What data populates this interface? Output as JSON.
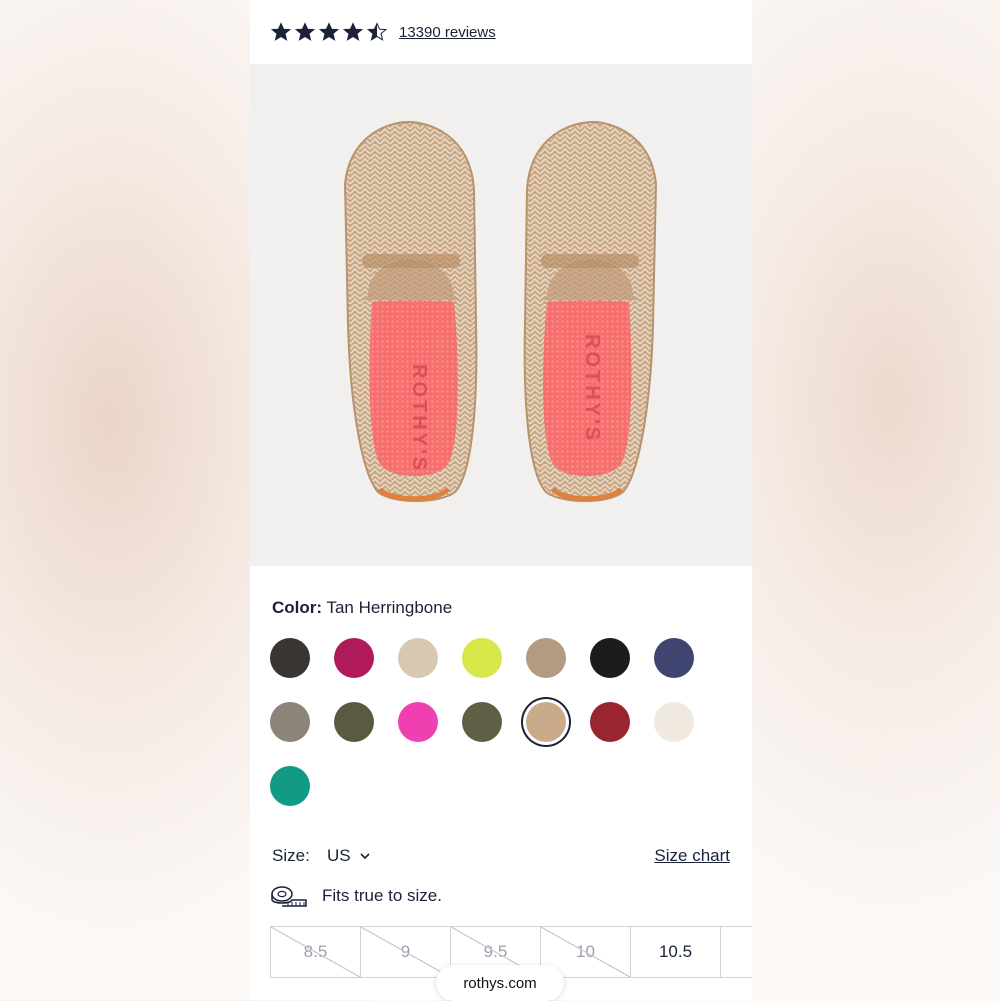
{
  "rating": {
    "value": 4.5,
    "max": 5,
    "reviews_label": "13390 reviews",
    "star_color": "#1a2238"
  },
  "product_image": {
    "insole_brand": "ROTHY'S"
  },
  "color": {
    "label": "Color:",
    "value": "Tan Herringbone"
  },
  "swatches": [
    {
      "name": "leopard",
      "color": "#3a3530"
    },
    {
      "name": "raspberry",
      "color": "#b0195a"
    },
    {
      "name": "beige",
      "color": "#d8c7b1"
    },
    {
      "name": "lime",
      "color": "#d7e649"
    },
    {
      "name": "tan-weave",
      "color": "#b39a80"
    },
    {
      "name": "black",
      "color": "#1c1c1c"
    },
    {
      "name": "navy",
      "color": "#3f4470"
    },
    {
      "name": "grey-herringbone",
      "color": "#8c8479"
    },
    {
      "name": "olive",
      "color": "#5a5a42"
    },
    {
      "name": "pink",
      "color": "#ef3fb0"
    },
    {
      "name": "camo",
      "color": "#5f5f45"
    },
    {
      "name": "tan-herringbone",
      "color": "#c9ab8c",
      "selected": true
    },
    {
      "name": "crimson",
      "color": "#9a2530"
    },
    {
      "name": "cream",
      "color": "#efe9df"
    },
    {
      "name": "teal",
      "color": "#119a84"
    }
  ],
  "size": {
    "label": "Size:",
    "unit": "US",
    "chart_link": "Size chart"
  },
  "fit": {
    "text": "Fits true to size."
  },
  "sizes": [
    {
      "label": "8.5",
      "available": false
    },
    {
      "label": "9",
      "available": false
    },
    {
      "label": "9.5",
      "available": false
    },
    {
      "label": "10",
      "available": false
    },
    {
      "label": "10.5",
      "available": true
    },
    {
      "label": "",
      "available": true
    }
  ],
  "browser": {
    "url": "rothys.com"
  }
}
